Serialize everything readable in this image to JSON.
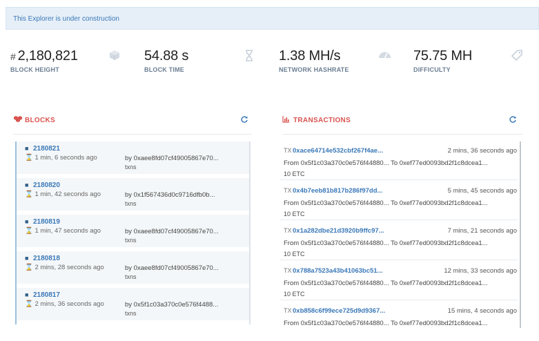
{
  "banner": {
    "text": "This Explorer is under construction"
  },
  "stats": [
    {
      "prefix": "#",
      "value": "2,180,821",
      "label": "BLOCK HEIGHT",
      "icon": "cube-icon"
    },
    {
      "prefix": "",
      "value": "54.88 s",
      "label": "BLOCK TIME",
      "icon": "hourglass-icon"
    },
    {
      "prefix": "",
      "value": "1.38 MH/s",
      "label": "NETWORK HASHRATE",
      "icon": "dashboard-icon"
    },
    {
      "prefix": "",
      "value": "75.75 MH",
      "label": "DIFFICULTY",
      "icon": "tag-icon"
    }
  ],
  "blocks_panel": {
    "title": "BLOCKS",
    "items": [
      {
        "number": "2180821",
        "age": "1 min, 6 seconds ago",
        "by": "by 0xaee8fd07cf49005867e70...",
        "txns": "txns"
      },
      {
        "number": "2180820",
        "age": "1 min, 42 seconds ago",
        "by": "by 0x1f567436d0c9716dfb0b...",
        "txns": "txns"
      },
      {
        "number": "2180819",
        "age": "1 min, 47 seconds ago",
        "by": "by 0xaee8fd07cf49005867e70...",
        "txns": "txns"
      },
      {
        "number": "2180818",
        "age": "2 mins, 28 seconds ago",
        "by": "by 0xaee8fd07cf49005867e70...",
        "txns": "txns"
      },
      {
        "number": "2180817",
        "age": "2 mins, 36 seconds ago",
        "by": "by 0x5f1c03a370c0e576f4488...",
        "txns": "txns"
      }
    ]
  },
  "transactions_panel": {
    "title": "TRANSACTIONS",
    "items": [
      {
        "prefix": "TX",
        "hash": "0xace64714e532cbf267f4ae...",
        "age": "2 mins, 36 seconds ago",
        "from": "From 0x5f1c03a370c0e576f44880...",
        "to": "To 0xef77ed0093bd2f1c8dcea1...",
        "amount": "10 ETC"
      },
      {
        "prefix": "TX",
        "hash": "0x4b7eeb81b817b286f97dd...",
        "age": "5 mins, 45 seconds ago",
        "from": "From 0x5f1c03a370c0e576f44880...",
        "to": "To 0xef77ed0093bd2f1c8dcea1...",
        "amount": "10 ETC"
      },
      {
        "prefix": "TX",
        "hash": "0x1a282dbe21d3920b9ffc97...",
        "age": "7 mins, 21 seconds ago",
        "from": "From 0x5f1c03a370c0e576f44880...",
        "to": "To 0xef77ed0093bd2f1c8dcea1...",
        "amount": "10 ETC"
      },
      {
        "prefix": "TX",
        "hash": "0x788a7523a43b41063bc51...",
        "age": "12 mins, 33 seconds ago",
        "from": "From 0x5f1c03a370c0e576f44880...",
        "to": "To 0xef77ed0093bd2f1c8dcea1...",
        "amount": "10 ETC"
      },
      {
        "prefix": "TX",
        "hash": "0xb858c6f99ece725d9d9367...",
        "age": "15 mins, 4 seconds ago",
        "from": "From 0x5f1c03a370c0e576f44880...",
        "to": "To 0xef77ed0093bd2f1c8dcea1...",
        "amount": ""
      }
    ]
  },
  "colors": {
    "accent": "#3a78b8",
    "danger": "#d9534f",
    "banner_bg": "#e6eff8",
    "label": "#6b7d92"
  }
}
